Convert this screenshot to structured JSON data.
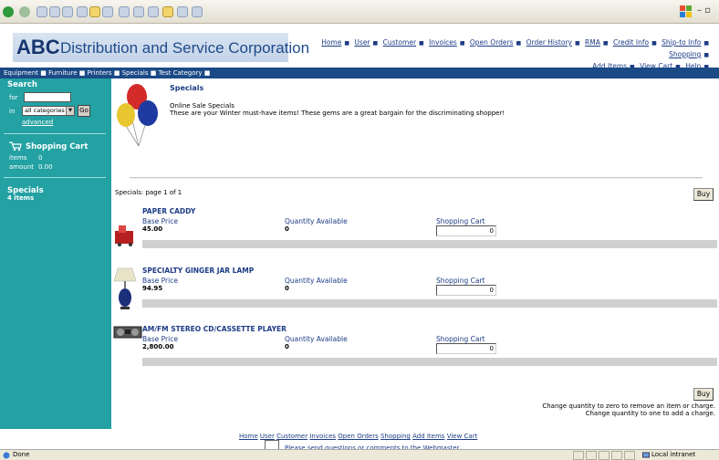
{
  "colors": {
    "sidebar": "#23a1a3",
    "category_bar": "#1b4a86",
    "link": "#1d3c86",
    "brand_bg": "#c9d8ec"
  },
  "brand": {
    "abc": "ABC",
    "rest": "Distribution and Service Corporation"
  },
  "top_nav": {
    "row1": [
      "Home",
      "User",
      "Customer",
      "Invoices",
      "Open Orders",
      "Order History",
      "RMA",
      "Credit Info",
      "Ship-to Info",
      "Shopping"
    ],
    "row2": [
      "Add Items",
      "View Cart",
      "Help"
    ]
  },
  "category_bar": [
    "Equipment",
    "Furniture",
    "Printers",
    "Specials",
    "Test Category"
  ],
  "sidebar": {
    "search_heading": "Search",
    "for_label": "for",
    "in_label": "in",
    "category_select": "all categories",
    "go_label": "Go",
    "advanced_link": "advanced",
    "cart_heading": "Shopping Cart",
    "items_label": "items",
    "items_value": "0",
    "amount_label": "amount",
    "amount_value": "0.00",
    "specials_heading": "Specials",
    "specials_count": "4 items"
  },
  "main": {
    "title": "Specials",
    "promo_line1": "Online Sale Specials",
    "promo_line2": "These are your Winter must-have items! These gems are a great bargain for the discriminating shopper!",
    "paging": "Specials: page 1 of 1",
    "buy_label": "Buy",
    "base_price_label": "Base Price",
    "qty_label": "Quantity Available",
    "cart_label": "Shopping Cart",
    "products": [
      {
        "name": "PAPER CADDY",
        "price": "45.00",
        "qty": "0",
        "cart_qty": "0"
      },
      {
        "name": "SPECIALTY GINGER JAR LAMP",
        "price": "94.95",
        "qty": "0",
        "cart_qty": "0"
      },
      {
        "name": "AM/FM STEREO CD/CASSETTE PLAYER",
        "price": "2,800.00",
        "qty": "0",
        "cart_qty": "0"
      }
    ],
    "note1": "Change quantity to zero to remove an item or charge.",
    "note2": "Change quantity to one to add a charge."
  },
  "footer": {
    "links": [
      "Home",
      "User",
      "Customer",
      "Invoices",
      "Open Orders",
      "Shopping",
      "Add Items",
      "View Cart"
    ],
    "note": "Please send questions or comments to the Webmaster."
  },
  "status": {
    "left": "Done",
    "zone": "Local intranet"
  }
}
